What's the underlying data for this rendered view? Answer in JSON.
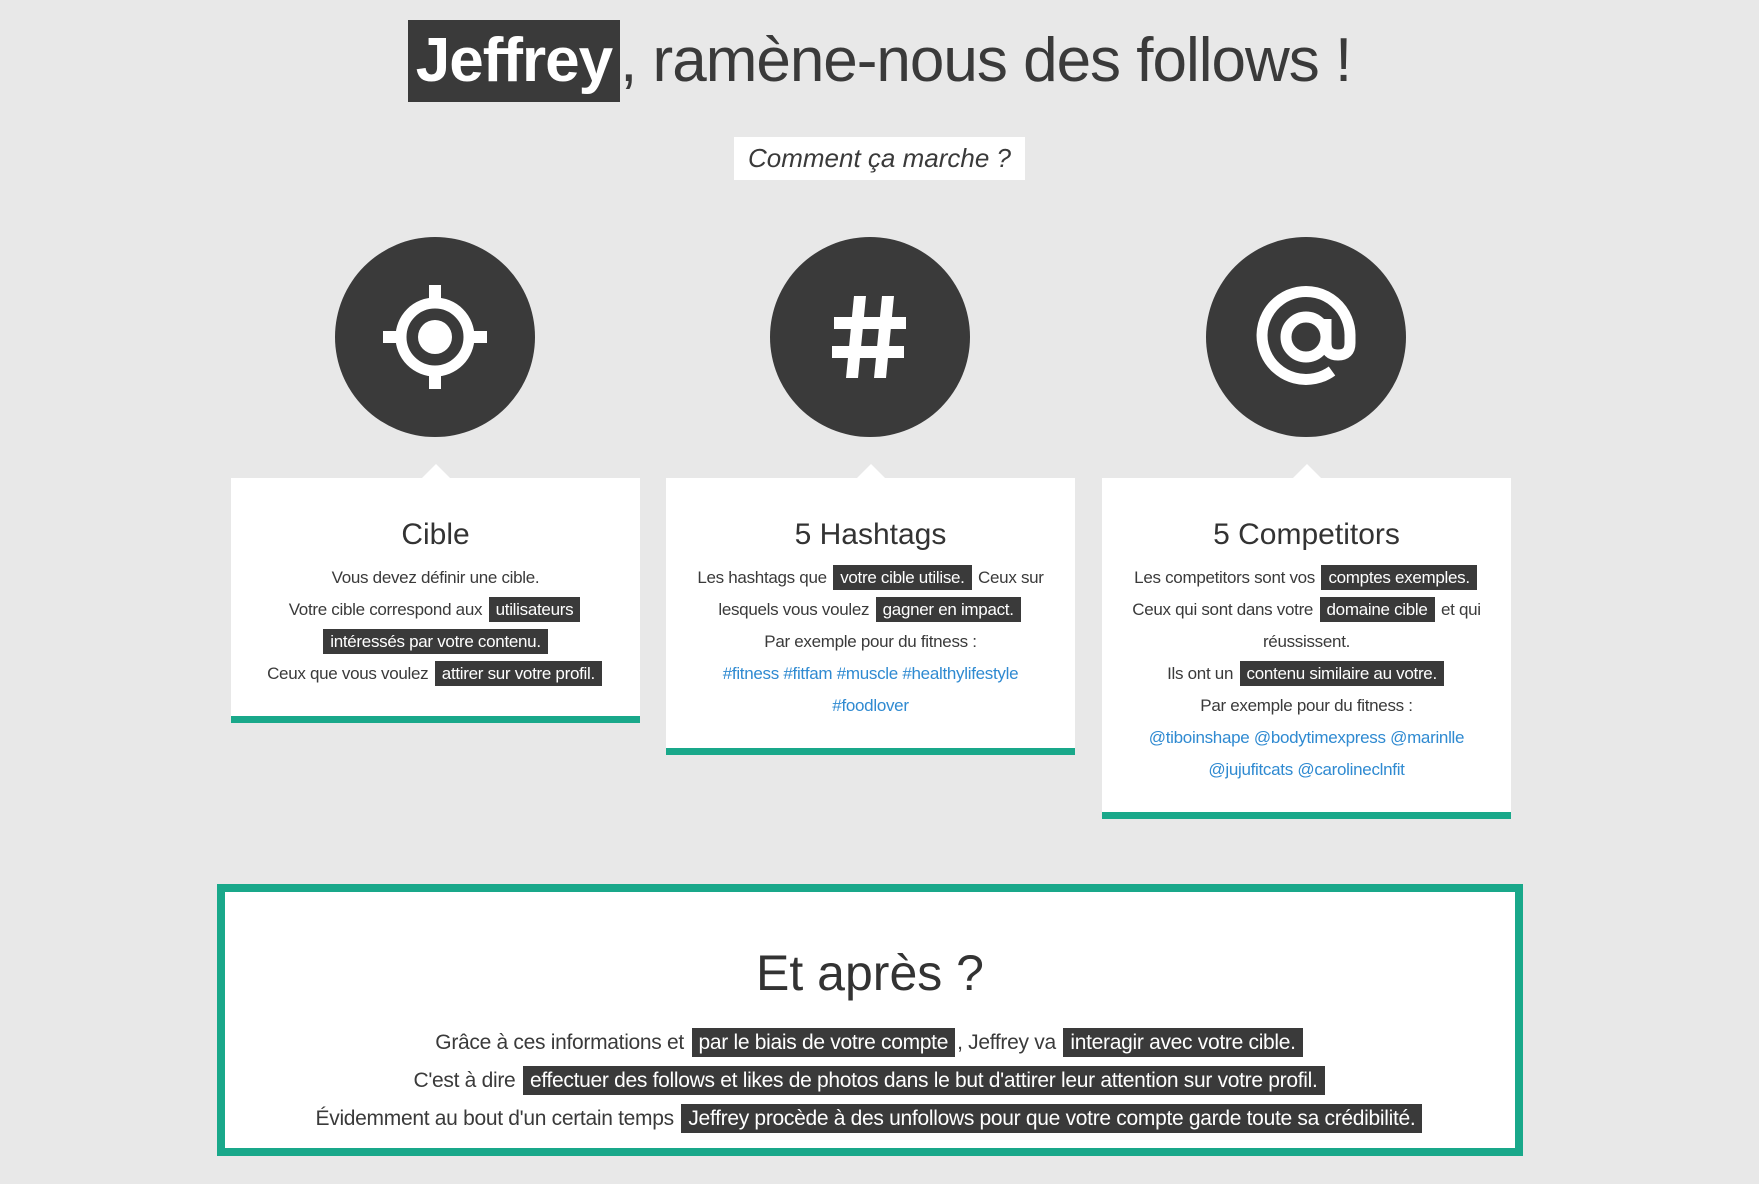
{
  "header": {
    "brand": "Jeffrey",
    "title_rest": ", ramène-nous des follows !",
    "subtitle": "Comment ça marche ?"
  },
  "icons": {
    "target": "crosshair-icon",
    "hashtag": "hashtag-icon",
    "at": "at-icon"
  },
  "cards": {
    "cible": {
      "title": "Cible",
      "line1": "Vous devez définir une cible.",
      "line2_pre": "Votre cible correspond aux",
      "line2_hl": "utilisateurs intéressés par votre contenu.",
      "line3_pre": "Ceux que vous voulez",
      "line3_hl": "attirer sur votre profil."
    },
    "hashtags": {
      "title": "5 Hashtags",
      "l1_pre": "Les hashtags que",
      "l1_hl": "votre cible utilise.",
      "l1_post": "Ceux sur lesquels vous voulez",
      "l1_hl2": "gagner en impact.",
      "example": "Par exemple pour du fitness :",
      "tags": [
        "#fitness",
        "#fitfam",
        "#muscle",
        "#healthylifestyle",
        "#foodlover"
      ]
    },
    "competitors": {
      "title": "5 Competitors",
      "l1_pre": "Les competitors sont vos",
      "l1_hl": "comptes exemples.",
      "l2_pre": "Ceux qui sont dans votre",
      "l2_hl": "domaine cible",
      "l2_post": "et qui réussissent.",
      "l3_pre": "Ils ont un",
      "l3_hl": "contenu similaire au votre.",
      "example": "Par exemple pour du fitness :",
      "accounts": [
        "@tiboinshape",
        "@bodytimexpress",
        "@marinlle",
        "@jujufitcats",
        "@carolineclnfit"
      ]
    }
  },
  "after": {
    "title": "Et après ?",
    "p1_pre": "Grâce à ces informations et",
    "p1_hl": "par le biais de votre compte",
    "p1_mid": ", Jeffrey va",
    "p1_hl2": "interagir avec votre cible.",
    "p2_pre": "C'est à dire",
    "p2_hl": "effectuer des follows et likes de photos dans le but d'attirer leur attention sur votre profil.",
    "p3_pre": "Évidemment au bout d'un certain temps",
    "p3_hl": "Jeffrey procède à des unfollows pour que votre compte garde toute sa crédibilité."
  },
  "colors": {
    "background": "#e8e8e8",
    "dark": "#3a3a3a",
    "accent": "#19a88a",
    "link": "#2f8ad1"
  }
}
